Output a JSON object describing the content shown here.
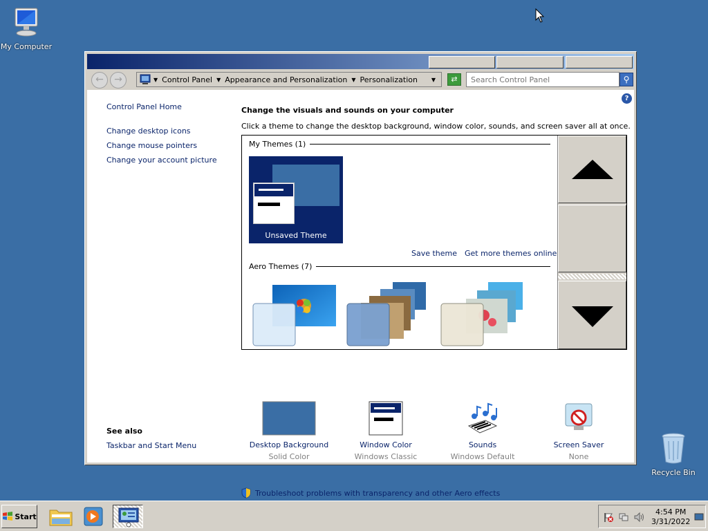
{
  "desktop": {
    "my_computer": "My Computer",
    "recycle_bin": "Recycle Bin"
  },
  "toolbar": {
    "breadcrumbs": [
      "Control Panel",
      "Appearance and Personalization",
      "Personalization"
    ],
    "search_placeholder": "Search Control Panel"
  },
  "sidebar": {
    "home": "Control Panel Home",
    "links": [
      "Change desktop icons",
      "Change mouse pointers",
      "Change your account picture"
    ],
    "see_also_title": "See also",
    "see_also_links": [
      "Taskbar and Start Menu"
    ]
  },
  "main": {
    "title": "Change the visuals and sounds on your computer",
    "subtitle": "Click a theme to change the desktop background, window color, sounds, and screen saver all at once.",
    "my_themes_header": "My Themes (1)",
    "unsaved_theme": "Unsaved Theme",
    "save_theme": "Save theme",
    "get_more_themes": "Get more themes online",
    "aero_themes_header": "Aero Themes (7)"
  },
  "settings": [
    {
      "name": "Desktop Background",
      "value": "Solid Color"
    },
    {
      "name": "Window Color",
      "value": "Windows Classic"
    },
    {
      "name": "Sounds",
      "value": "Windows Default"
    },
    {
      "name": "Screen Saver",
      "value": "None"
    }
  ],
  "troubleshoot": "Troubleshoot problems with transparency and other Aero effects",
  "taskbar": {
    "start": "Start",
    "time": "4:54 PM",
    "date": "3/31/2022"
  },
  "colors": {
    "desktop": "#3a6ea5",
    "link": "#0a246a",
    "classic_gray": "#d4d0c8"
  }
}
